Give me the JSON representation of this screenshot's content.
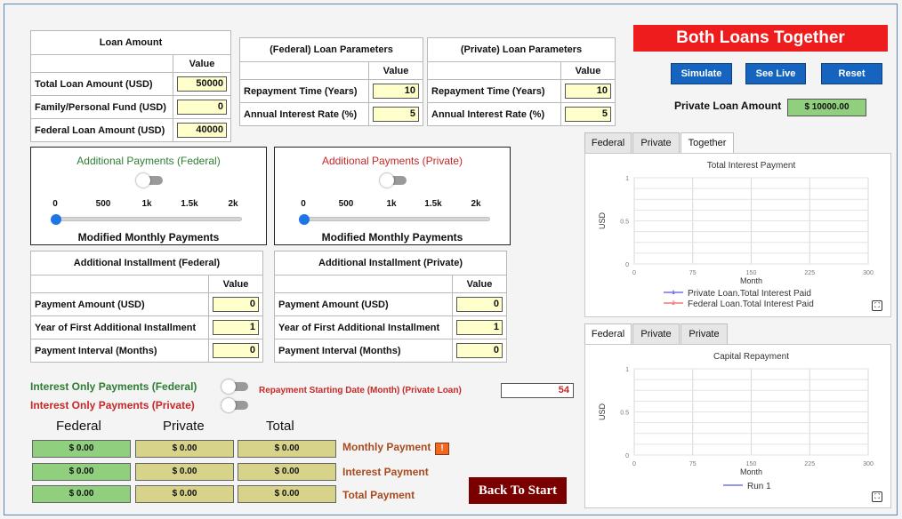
{
  "title_banner": "Both Loans Together",
  "loan_amount": {
    "title": "Loan Amount",
    "value_header": "Value",
    "rows": [
      {
        "label": "Total Loan Amount (USD)",
        "value": "50000"
      },
      {
        "label": "Family/Personal Fund (USD)",
        "value": "0"
      },
      {
        "label": "Federal Loan Amount (USD)",
        "value": "40000"
      }
    ]
  },
  "federal_params": {
    "title": "(Federal) Loan Parameters",
    "value_header": "Value",
    "rows": [
      {
        "label": "Repayment Time (Years)",
        "value": "10"
      },
      {
        "label": "Annual Interest Rate (%)",
        "value": "5"
      }
    ]
  },
  "private_params": {
    "title": "(Private) Loan Parameters",
    "value_header": "Value",
    "rows": [
      {
        "label": "Repayment Time (Years)",
        "value": "10"
      },
      {
        "label": "Annual Interest Rate (%)",
        "value": "5"
      }
    ]
  },
  "buttons": {
    "simulate": "Simulate",
    "see_live": "See Live",
    "reset": "Reset",
    "back": "Back To Start"
  },
  "private_loan_amount": {
    "label": "Private Loan Amount",
    "value": "$ 10000.00"
  },
  "addpay_federal": {
    "title": "Additional Payments (Federal)",
    "ticks": [
      "0",
      "500",
      "1k",
      "1.5k",
      "2k"
    ],
    "slider_value": 0,
    "modified": "Modified Monthly Payments",
    "title_color": "#2e7d32"
  },
  "addpay_private": {
    "title": "Additional Payments (Private)",
    "ticks": [
      "0",
      "500",
      "1k",
      "1.5k",
      "2k"
    ],
    "slider_value": 0,
    "modified": "Modified Monthly Payments",
    "title_color": "#c62828"
  },
  "installment_federal": {
    "title": "Additional Installment (Federal)",
    "value_header": "Value",
    "rows": [
      {
        "label": "Payment Amount (USD)",
        "value": "0"
      },
      {
        "label": "Year of First Additional Installment",
        "value": "1"
      },
      {
        "label": "Payment Interval (Months)",
        "value": "0"
      }
    ]
  },
  "installment_private": {
    "title": "Additional Installment (Private)",
    "value_header": "Value",
    "rows": [
      {
        "label": "Payment Amount (USD)",
        "value": "0"
      },
      {
        "label": "Year of First Additional Installment",
        "value": "1"
      },
      {
        "label": "Payment Interval (Months)",
        "value": "0"
      }
    ]
  },
  "interest_only": {
    "federal": "Interest Only Payments (Federal)",
    "private": "Interest Only Payments (Private)"
  },
  "repay_start": {
    "label": "Repayment Starting Date (Month) (Private Loan)",
    "value": "54"
  },
  "results": {
    "headers": [
      "Federal",
      "Private",
      "Total"
    ],
    "rows": [
      {
        "label": "Monthly Payment",
        "values": [
          "$ 0.00",
          "$ 0.00",
          "$ 0.00"
        ]
      },
      {
        "label": "Interest Payment",
        "values": [
          "$ 0.00",
          "$ 0.00",
          "$ 0.00"
        ]
      },
      {
        "label": "Total Payment",
        "values": [
          "$ 0.00",
          "$ 0.00",
          "$ 0.00"
        ]
      }
    ],
    "warning_glyph": "!"
  },
  "chart_tabs_top": [
    {
      "label": "Federal"
    },
    {
      "label": "Private"
    },
    {
      "label": "Together",
      "active": true
    }
  ],
  "chart_tabs_bottom": [
    {
      "label": "Federal",
      "active": true
    },
    {
      "label": "Private"
    },
    {
      "label": "Private"
    }
  ],
  "chart_data": [
    {
      "type": "line",
      "title": "Total Interest Payment",
      "xlabel": "Month",
      "ylabel": "USD",
      "xlim": [
        0,
        300
      ],
      "ylim": [
        0,
        1
      ],
      "xticks": [
        "0",
        "75",
        "150",
        "225",
        "300"
      ],
      "yticks": [
        "0",
        "0.5",
        "1"
      ],
      "grid": true,
      "series": [
        {
          "name": "Private Loan.Total Interest Paid",
          "color": "#2b2bd6",
          "marker": "1",
          "x": [],
          "y": []
        },
        {
          "name": "Federal Loan.Total Interest Paid",
          "color": "#e53935",
          "marker": "2",
          "x": [],
          "y": []
        }
      ]
    },
    {
      "type": "line",
      "title": "Capital Repayment",
      "xlabel": "Month",
      "ylabel": "USD",
      "xlim": [
        0,
        300
      ],
      "ylim": [
        0,
        1
      ],
      "xticks": [
        "0",
        "75",
        "150",
        "225",
        "300"
      ],
      "yticks": [
        "0",
        "0.5",
        "1"
      ],
      "grid": true,
      "series": [
        {
          "name": "Run 1",
          "color": "#2b2bd6",
          "marker": "",
          "x": [],
          "y": []
        }
      ]
    }
  ]
}
